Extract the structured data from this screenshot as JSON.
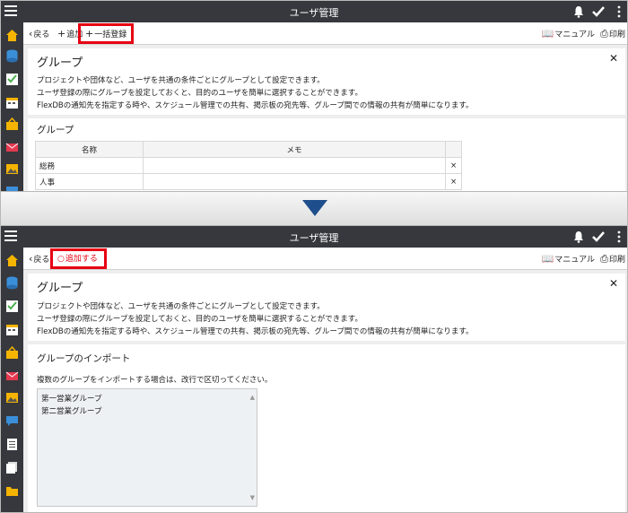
{
  "titlebar": {
    "title": "ユーザ管理"
  },
  "top": {
    "toolbar": {
      "back": "戻る",
      "add": "追加",
      "bulk": "一括登録",
      "manual": "マニュアル",
      "print": "印刷"
    },
    "panel": {
      "title": "グループ",
      "lines": [
        "プロジェクトや団体など、ユーザを共通の条件ごとにグループとして設定できます。",
        "ユーザ登録の際にグループを設定しておくと、目的のユーザを簡単に選択することができます。",
        "FlexDBの通知先を指定する時や、スケジュール管理での共有、掲示板の宛先等、グループ間での情報の共有が簡単になります。"
      ]
    },
    "section": {
      "title": "グループ",
      "headers": {
        "name": "名称",
        "memo": "メモ"
      },
      "rows": [
        {
          "name": "総務",
          "memo": ""
        },
        {
          "name": "人事",
          "memo": ""
        }
      ],
      "delete_glyph": "×"
    }
  },
  "bottom": {
    "toolbar": {
      "back": "戻る",
      "add_confirm": "追加する",
      "manual": "マニュアル",
      "print": "印刷"
    },
    "panel": {
      "title": "グループ",
      "lines": [
        "プロジェクトや団体など、ユーザを共通の条件ごとにグループとして設定できます。",
        "ユーザ登録の際にグループを設定しておくと、目的のユーザを簡単に選択することができます。",
        "FlexDBの通知先を指定する時や、スケジュール管理での共有、掲示板の宛先等、グループ間での情報の共有が簡単になります。"
      ]
    },
    "import": {
      "title": "グループのインポート",
      "hint": "複数のグループをインポートする場合は、改行で区切ってください。",
      "lines": [
        "第一営業グループ",
        "第二営業グループ"
      ]
    }
  },
  "colors": {
    "titlebar": "#36383d",
    "highlight": "#e60012",
    "arrow": "#1f4e8c",
    "sidebar_home": "#f5b400",
    "sidebar_db": "#3b8fd9",
    "sidebar_todo": "#4caf50",
    "sidebar_mail": "#e53950"
  },
  "icons": [
    "menu-icon",
    "bell-icon",
    "check-icon",
    "kebab-icon",
    "back-icon",
    "plus-icon",
    "book-icon",
    "printer-icon",
    "close-icon",
    "down-arrow-icon"
  ]
}
